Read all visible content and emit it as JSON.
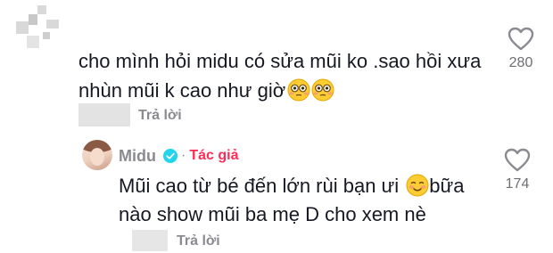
{
  "comment1": {
    "text_line1": "cho mình hỏi midu có sửa mũi ko .sao hồi xưa",
    "text_line2": "nhùn mũi k cao như giờ",
    "emoji": "flushed-face-emoji",
    "reply_label": "Trả lời",
    "like_count": "280"
  },
  "comment2": {
    "author": "Midu",
    "separator": "·",
    "author_badge": "Tác giả",
    "text_line1_before_emoji": "Mũi cao từ bé đến lớn rùi bạn ưi",
    "emoji": "smiling-face-emoji",
    "text_line1_after_emoji": "bữa",
    "text_line2": "nào show mũi ba mẹ D cho xem nè",
    "reply_label": "Trả lời",
    "like_count": "174"
  },
  "colors": {
    "text": "#161823",
    "muted": "#8a8b91",
    "author_badge": "#fe2c55",
    "verified": "#20d5ec"
  },
  "icons": {
    "like": "heart-outline-icon",
    "verified": "verified-check-icon"
  }
}
